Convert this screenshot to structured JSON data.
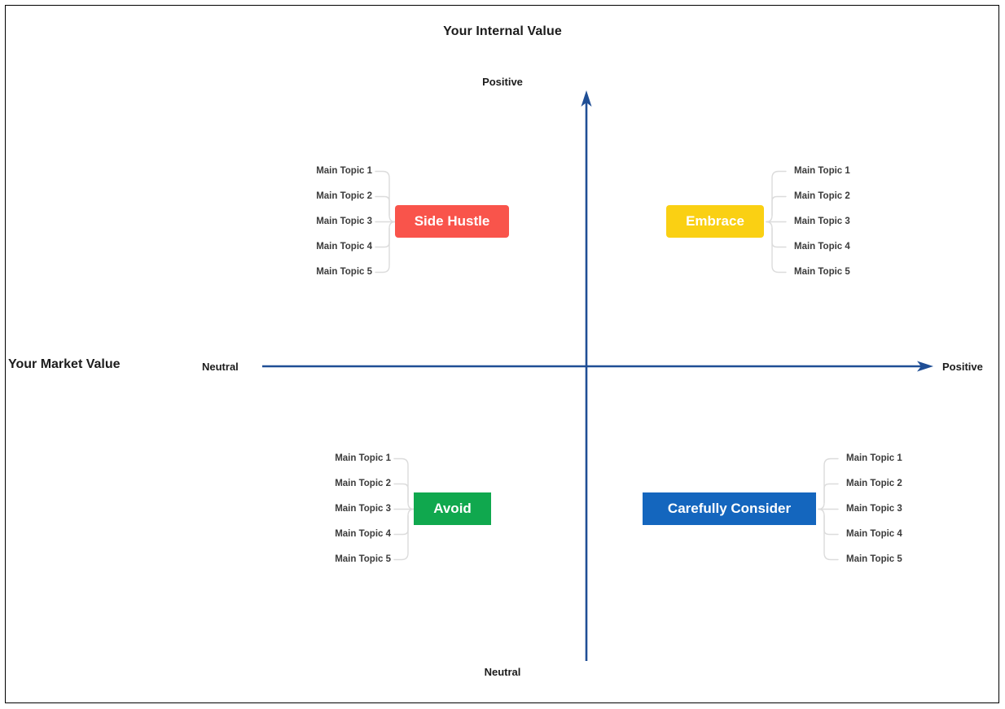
{
  "chart": {
    "title": "Your Internal Value",
    "y_axis_name": "Your Internal Value",
    "x_axis_name": "Your Market Value",
    "y_top_label": "Positive",
    "y_bottom_label": "Neutral",
    "x_left_label": "Neutral",
    "x_right_label": "Positive",
    "axis_color": "#1f4e95",
    "border_color": "#000000"
  },
  "chart_data": {
    "type": "scatter",
    "title": "Your Internal Value",
    "xlabel": "Your Market Value",
    "ylabel": "Your Internal Value",
    "x_ticks": [
      "Neutral",
      "Positive"
    ],
    "y_ticks": [
      "Neutral",
      "Positive"
    ],
    "grid": false,
    "legend": "none",
    "quadrants": [
      {
        "id": "top-left",
        "label": "Side Hustle",
        "color": "#f9544b",
        "text_color": "#ffffff",
        "x_region": "Neutral",
        "y_region": "Positive",
        "topics": [
          "Main Topic 1",
          "Main Topic 2",
          "Main Topic 3",
          "Main Topic 4",
          "Main Topic 5"
        ]
      },
      {
        "id": "top-right",
        "label": "Embrace",
        "color": "#fad013",
        "text_color": "#ffffff",
        "x_region": "Positive",
        "y_region": "Positive",
        "topics": [
          "Main Topic 1",
          "Main Topic 2",
          "Main Topic 3",
          "Main Topic 4",
          "Main Topic 5"
        ]
      },
      {
        "id": "bottom-left",
        "label": "Avoid",
        "color": "#10a84e",
        "text_color": "#ffffff",
        "x_region": "Neutral",
        "y_region": "Neutral",
        "topics": [
          "Main Topic 1",
          "Main Topic 2",
          "Main Topic 3",
          "Main Topic 4",
          "Main Topic 5"
        ]
      },
      {
        "id": "bottom-right",
        "label": "Carefully Consider",
        "color": "#1466be",
        "text_color": "#ffffff",
        "x_region": "Positive",
        "y_region": "Neutral",
        "topics": [
          "Main Topic 1",
          "Main Topic 2",
          "Main Topic 3",
          "Main Topic 4",
          "Main Topic 5"
        ]
      }
    ]
  },
  "quadrants": {
    "top_left": {
      "label": "Side Hustle",
      "topics": [
        "Main Topic 1",
        "Main Topic 2",
        "Main Topic 3",
        "Main Topic 4",
        "Main Topic 5"
      ]
    },
    "top_right": {
      "label": "Embrace",
      "topics": [
        "Main Topic 1",
        "Main Topic 2",
        "Main Topic 3",
        "Main Topic 4",
        "Main Topic 5"
      ]
    },
    "bottom_left": {
      "label": "Avoid",
      "topics": [
        "Main Topic 1",
        "Main Topic 2",
        "Main Topic 3",
        "Main Topic 4",
        "Main Topic 5"
      ]
    },
    "bottom_right": {
      "label": "Carefully Consider",
      "topics": [
        "Main Topic 1",
        "Main Topic 2",
        "Main Topic 3",
        "Main Topic 4",
        "Main Topic 5"
      ]
    }
  }
}
